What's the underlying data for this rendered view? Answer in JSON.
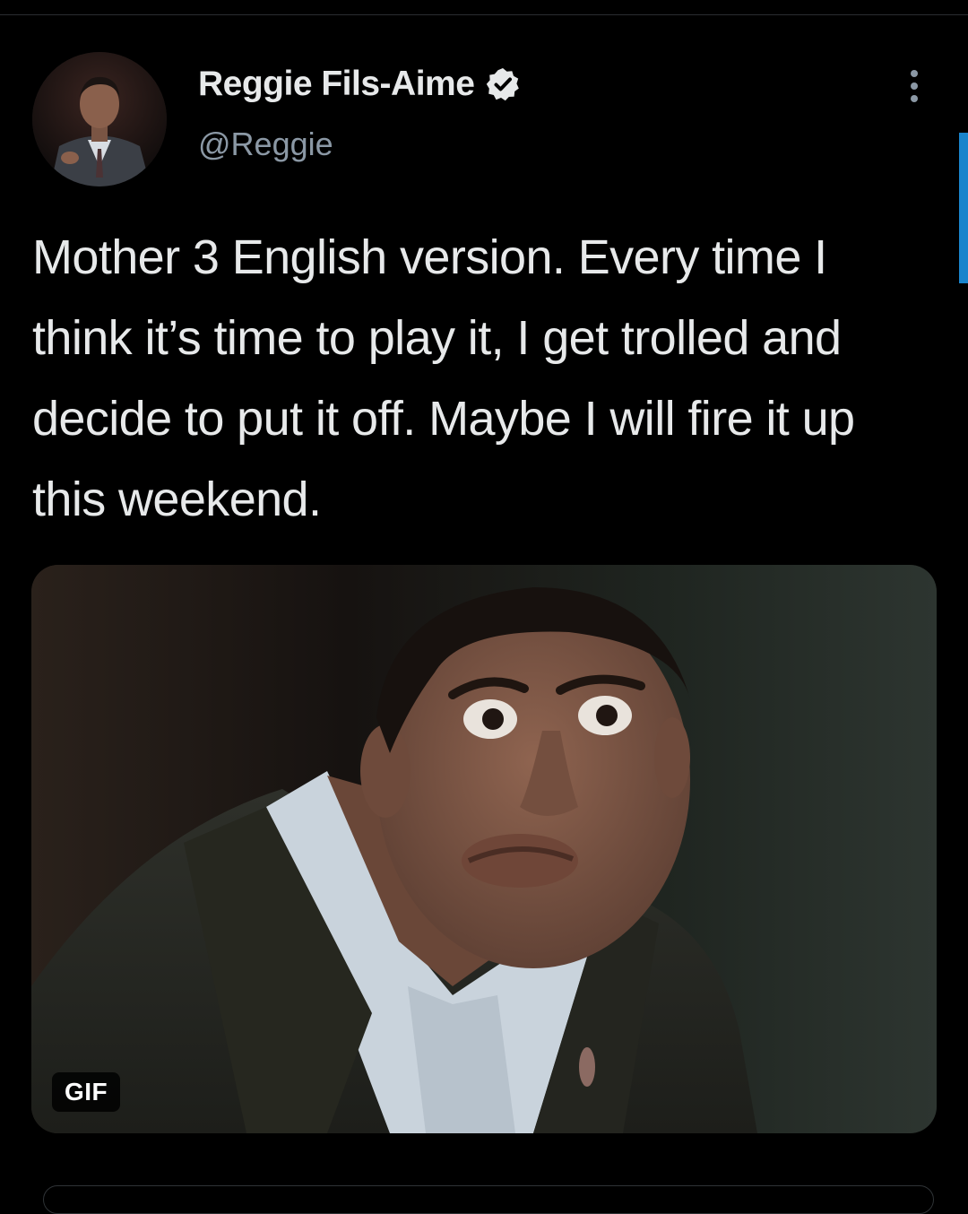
{
  "tweet": {
    "author": {
      "display_name": "Reggie Fils-Aime",
      "handle": "@Reggie",
      "verified": true,
      "avatar_icon": "profile-photo"
    },
    "text": "Mother 3 English version. Every time I think it’s time to play it, I get trolled and decide to put it off. Maybe I will fire it up this weekend.",
    "media": {
      "type": "gif",
      "badge_label": "GIF"
    }
  },
  "icons": {
    "verified": "verified-badge-icon",
    "more": "more-options-icon"
  },
  "colors": {
    "background": "#000000",
    "text_primary": "#e7e9ea",
    "text_secondary": "#8b98a5",
    "accent": "#1d9bf0"
  }
}
